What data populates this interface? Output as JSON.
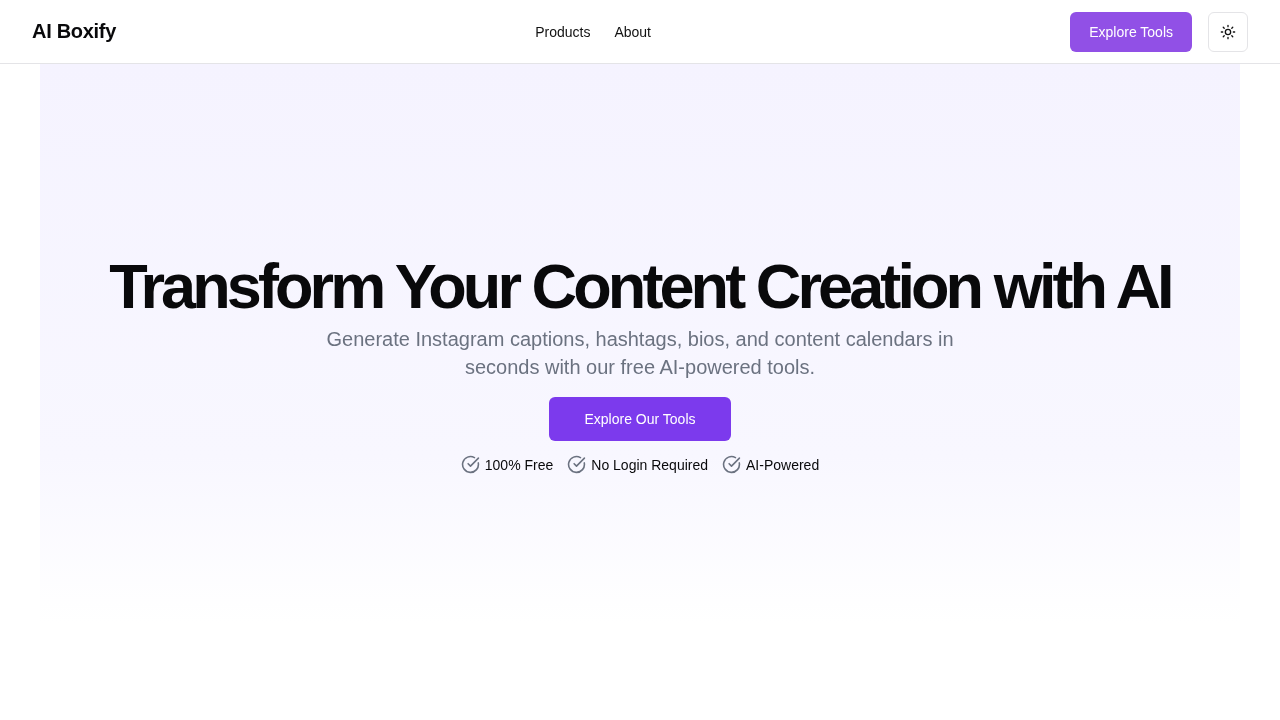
{
  "header": {
    "logo": "AI Boxify",
    "nav": [
      {
        "label": "Products"
      },
      {
        "label": "About"
      }
    ],
    "cta": "Explore Tools"
  },
  "hero": {
    "title": "Transform Your Content Creation with AI",
    "subtitle": "Generate Instagram captions, hashtags, bios, and content calendars in seconds with our free AI-powered tools.",
    "button": "Explore Our Tools",
    "features": [
      "100% Free",
      "No Login Required",
      "AI-Powered"
    ]
  }
}
